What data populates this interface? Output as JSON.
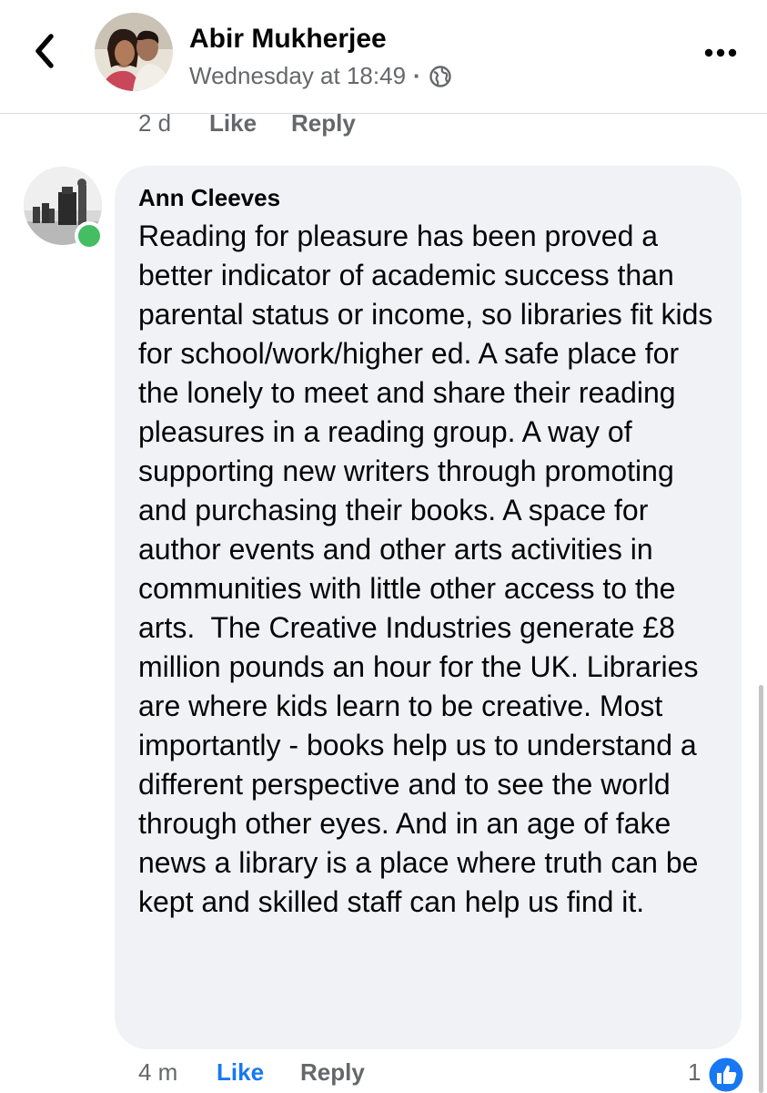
{
  "header": {
    "back_icon": "chevron-left-icon",
    "author_name": "Abir Mukherjee",
    "timestamp": "Wednesday at 18:49",
    "separator": "·",
    "privacy_icon": "globe-icon",
    "more_icon": "ellipsis-icon"
  },
  "previous_comment": {
    "time": "2 d",
    "like_label": "Like",
    "reply_label": "Reply"
  },
  "comment": {
    "author": "Ann Cleeves",
    "online": true,
    "text": "Reading for pleasure has been proved a better indicator of academic success than parental status or income, so libraries fit kids for school/work/higher ed. A safe place for the lonely to meet and share their reading pleasures in a reading group. A way of supporting new writers through promoting and purchasing their books. A space for author events and other arts activities in communities with little other access to the arts.  The Creative Industries generate £8 million pounds an hour for the UK. Libraries are where kids learn to be creative. Most importantly - books help us to understand a different perspective and to see the world through other eyes. And in an age of fake news a library is a place where truth can be kept and skilled staff can help us find it.",
    "time": "4 m",
    "like_label": "Like",
    "reply_label": "Reply",
    "reaction_count": "1",
    "reaction_icon": "thumbs-up-icon"
  },
  "colors": {
    "accent": "#1877f2",
    "secondary_text": "#65676b",
    "bubble_bg": "#f0f2f5",
    "online": "#45bd62"
  }
}
